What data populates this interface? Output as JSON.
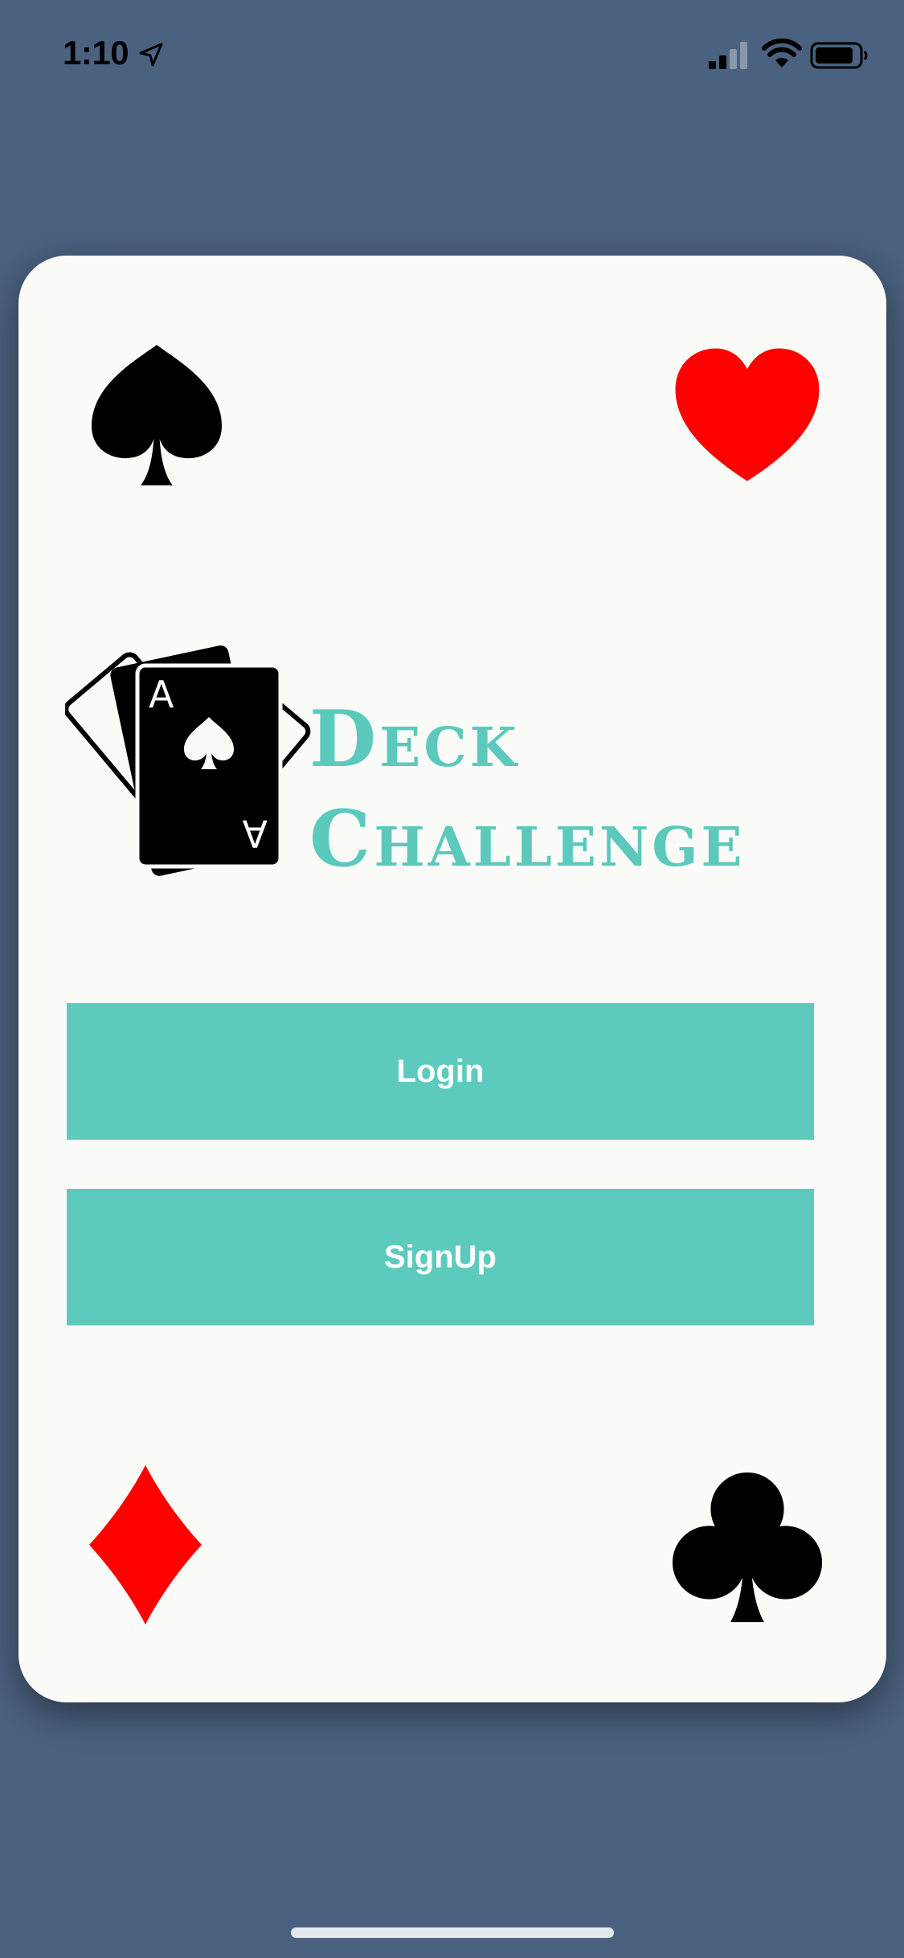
{
  "status_bar": {
    "time": "1:10",
    "icons": [
      "location-arrow-icon",
      "cellular-signal-icon",
      "wifi-icon",
      "battery-icon"
    ]
  },
  "card": {
    "corner_suits": [
      "spade-icon",
      "heart-icon",
      "diamond-icon",
      "club-icon"
    ],
    "logo": {
      "icon": "playing-cards-icon",
      "card_rank": "A",
      "title_line1": "Deck",
      "title_line2": "Challenge"
    },
    "buttons": {
      "login_label": "Login",
      "signup_label": "SignUp"
    }
  },
  "colors": {
    "background": "#4a6280",
    "card": "#fbfcf8",
    "accent": "#5ccbbd",
    "suit_red": "#ff0000",
    "suit_black": "#000000"
  }
}
